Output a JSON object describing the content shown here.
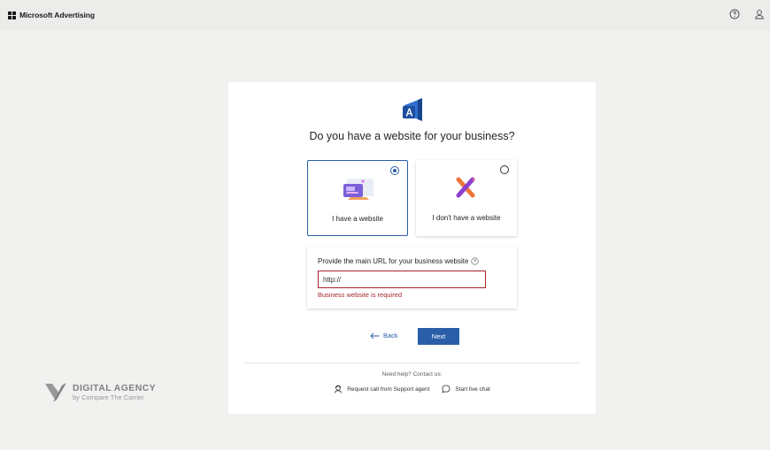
{
  "header": {
    "brand": "Microsoft Advertising",
    "icons": [
      "help-icon",
      "account-icon"
    ]
  },
  "page": {
    "question": "Do you have a website for your business?"
  },
  "options": [
    {
      "label": "I have a website",
      "selected": true,
      "icon": "website-illustration"
    },
    {
      "label": "I don't have a website",
      "selected": false,
      "icon": "no-website-illustration"
    }
  ],
  "url_field": {
    "label": "Provide the main URL for your business website",
    "value": "http://",
    "error": "Business website is required"
  },
  "nav": {
    "back_label": "Back",
    "next_label": "Next"
  },
  "help": {
    "text": "Need help? Contact us:",
    "call_label": "Request call from Support agent",
    "chat_label": "Start live chat"
  },
  "watermark": {
    "line1": "DIGITAL AGENCY",
    "line2": "by Compare The Carrier"
  },
  "colors": {
    "accent": "#2a5ea8",
    "error": "#a4262c",
    "background": "#f1f1f0"
  }
}
